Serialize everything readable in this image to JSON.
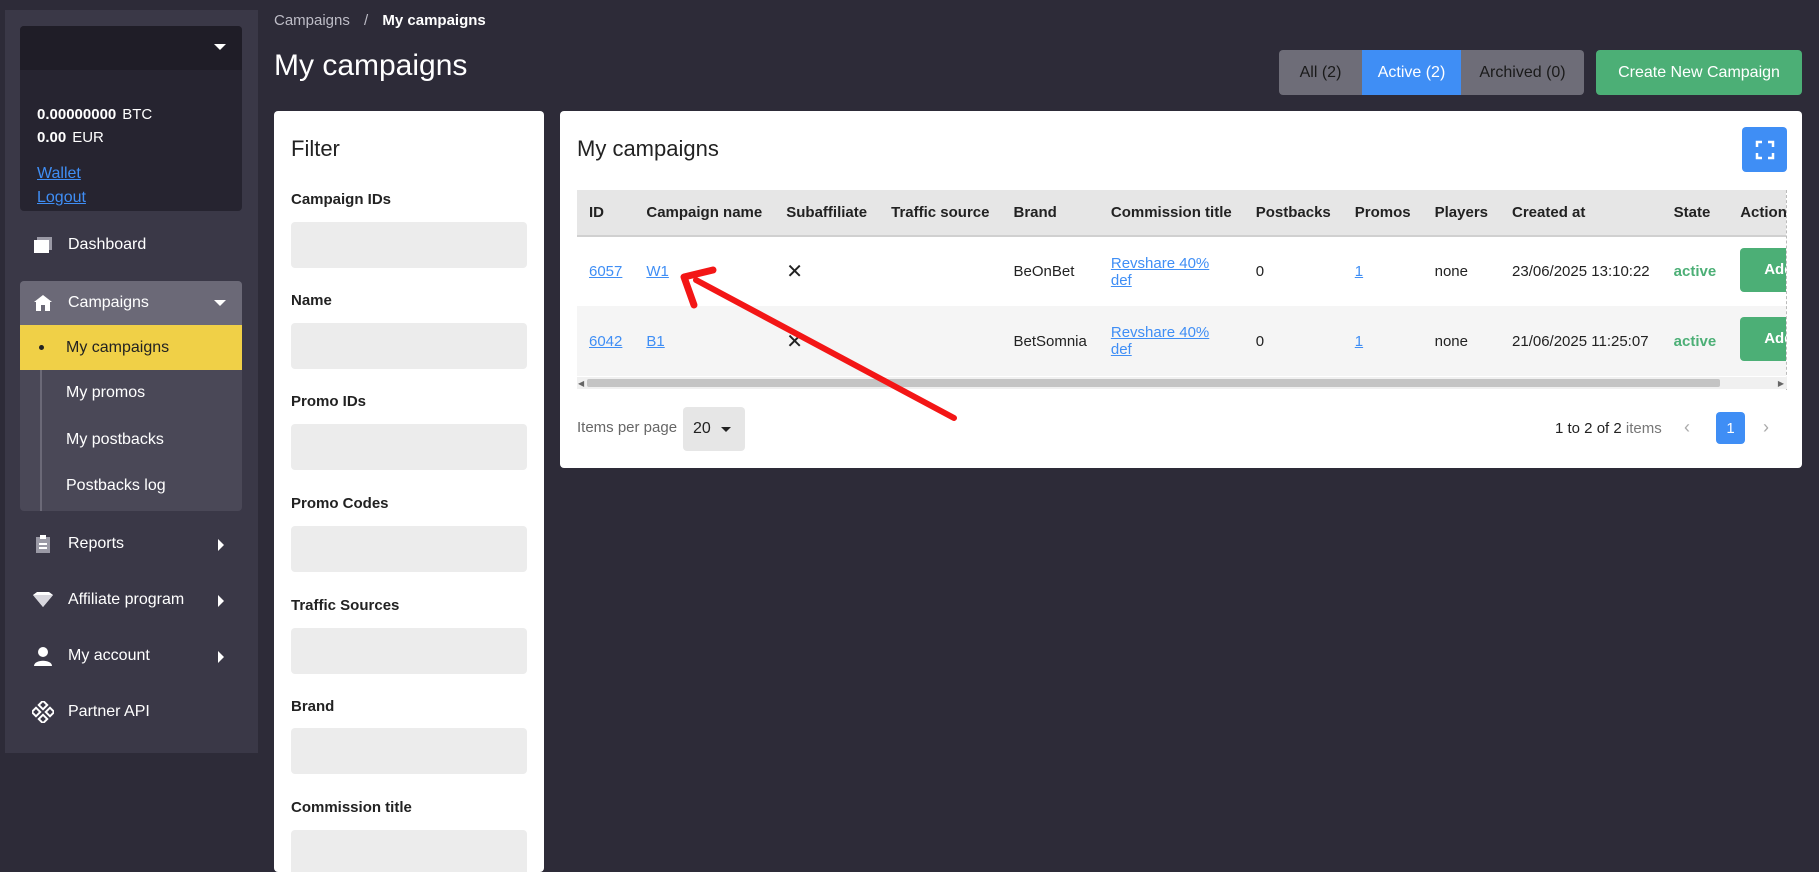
{
  "sidebar": {
    "balances": [
      {
        "amount": "0.00000000",
        "currency": "BTC"
      },
      {
        "amount": "0.00",
        "currency": "EUR"
      }
    ],
    "wallet": "Wallet",
    "logout": "Logout",
    "dashboard": "Dashboard",
    "campaigns": "Campaigns",
    "sub_items": [
      "My campaigns",
      "My promos",
      "My postbacks",
      "Postbacks log"
    ],
    "reports": "Reports",
    "affiliate": "Affiliate program",
    "account": "My account",
    "api": "Partner API"
  },
  "header": {
    "breadcrumb": [
      "Campaigns",
      "/",
      "My campaigns"
    ],
    "title": "My campaigns",
    "filters": {
      "all": "All (2)",
      "active": "Active (2)",
      "archived": "Archived (0)"
    },
    "create": "Create New Campaign"
  },
  "filter": {
    "title": "Filter",
    "fields": [
      "Campaign IDs",
      "Name",
      "Promo IDs",
      "Promo Codes",
      "Traffic Sources",
      "Brand",
      "Commission title"
    ]
  },
  "main": {
    "title": "My campaigns",
    "columns": [
      "ID",
      "Campaign name",
      "Subaffiliate",
      "Traffic source",
      "Brand",
      "Commission title",
      "Postbacks",
      "Promos",
      "Players",
      "Created at",
      "State",
      "Actions"
    ],
    "rows": [
      {
        "id": "6057",
        "name": "W1",
        "subaffiliate": "✕",
        "traffic": "",
        "brand": "BeOnBet",
        "commission_1": "Revshare 40%",
        "commission_2": "def",
        "postbacks": "0",
        "promos": "1",
        "players": "none",
        "created": "23/06/2025 13:10:22",
        "state": "active",
        "action": "Add Promo"
      },
      {
        "id": "6042",
        "name": "B1",
        "subaffiliate": "✕",
        "traffic": "",
        "brand": "BetSomnia",
        "commission_1": "Revshare 40%",
        "commission_2": "def",
        "postbacks": "0",
        "promos": "1",
        "players": "none",
        "created": "21/06/2025 11:25:07",
        "state": "active",
        "action": "Add Promo"
      }
    ],
    "pager": {
      "label": "Items per page",
      "per_page": "20",
      "range_strong": "1 to 2 of 2",
      "range_muted": "items",
      "page": "1"
    }
  },
  "colors": {
    "accent": "#3f8ef5",
    "success": "#4caf76",
    "highlight": "#f0d047",
    "arrow": "#f31616"
  }
}
